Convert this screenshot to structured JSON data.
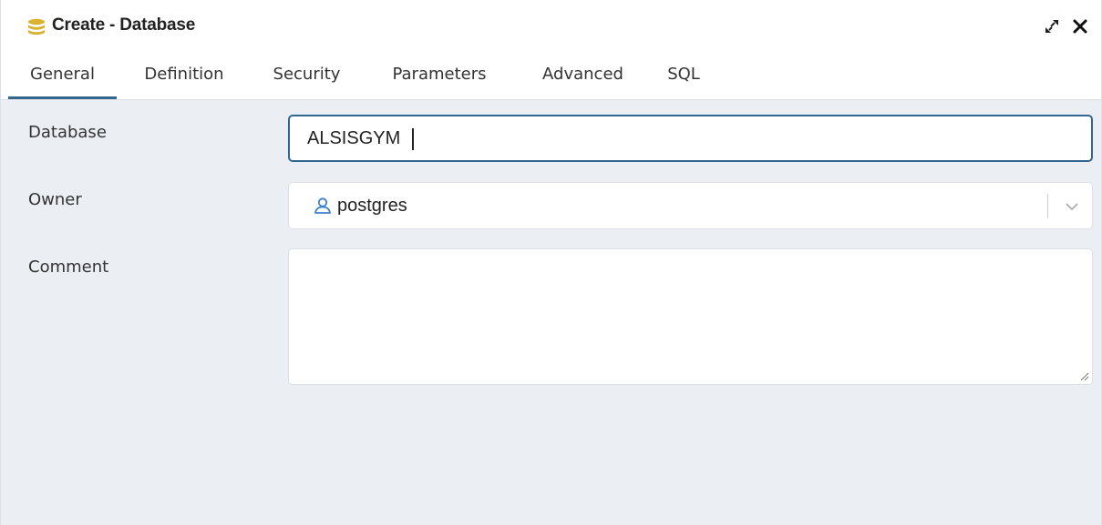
{
  "window": {
    "title": "Create - Database",
    "icons": {
      "title": "database-icon",
      "expand": "expand-icon",
      "close": "close-icon"
    }
  },
  "tabs": [
    {
      "label": "General",
      "active": true
    },
    {
      "label": "Definition",
      "active": false
    },
    {
      "label": "Security",
      "active": false
    },
    {
      "label": "Parameters",
      "active": false
    },
    {
      "label": "Advanced",
      "active": false
    },
    {
      "label": "SQL",
      "active": false
    }
  ],
  "form": {
    "database": {
      "label": "Database",
      "value": "ALSISGYM"
    },
    "owner": {
      "label": "Owner",
      "value": "postgres",
      "icon": "user-icon"
    },
    "comment": {
      "label": "Comment",
      "value": ""
    }
  },
  "colors": {
    "accent": "#326690",
    "body_bg": "#ebeef3",
    "title_icon": "#d8b431",
    "user_icon": "#3d7fcf"
  }
}
